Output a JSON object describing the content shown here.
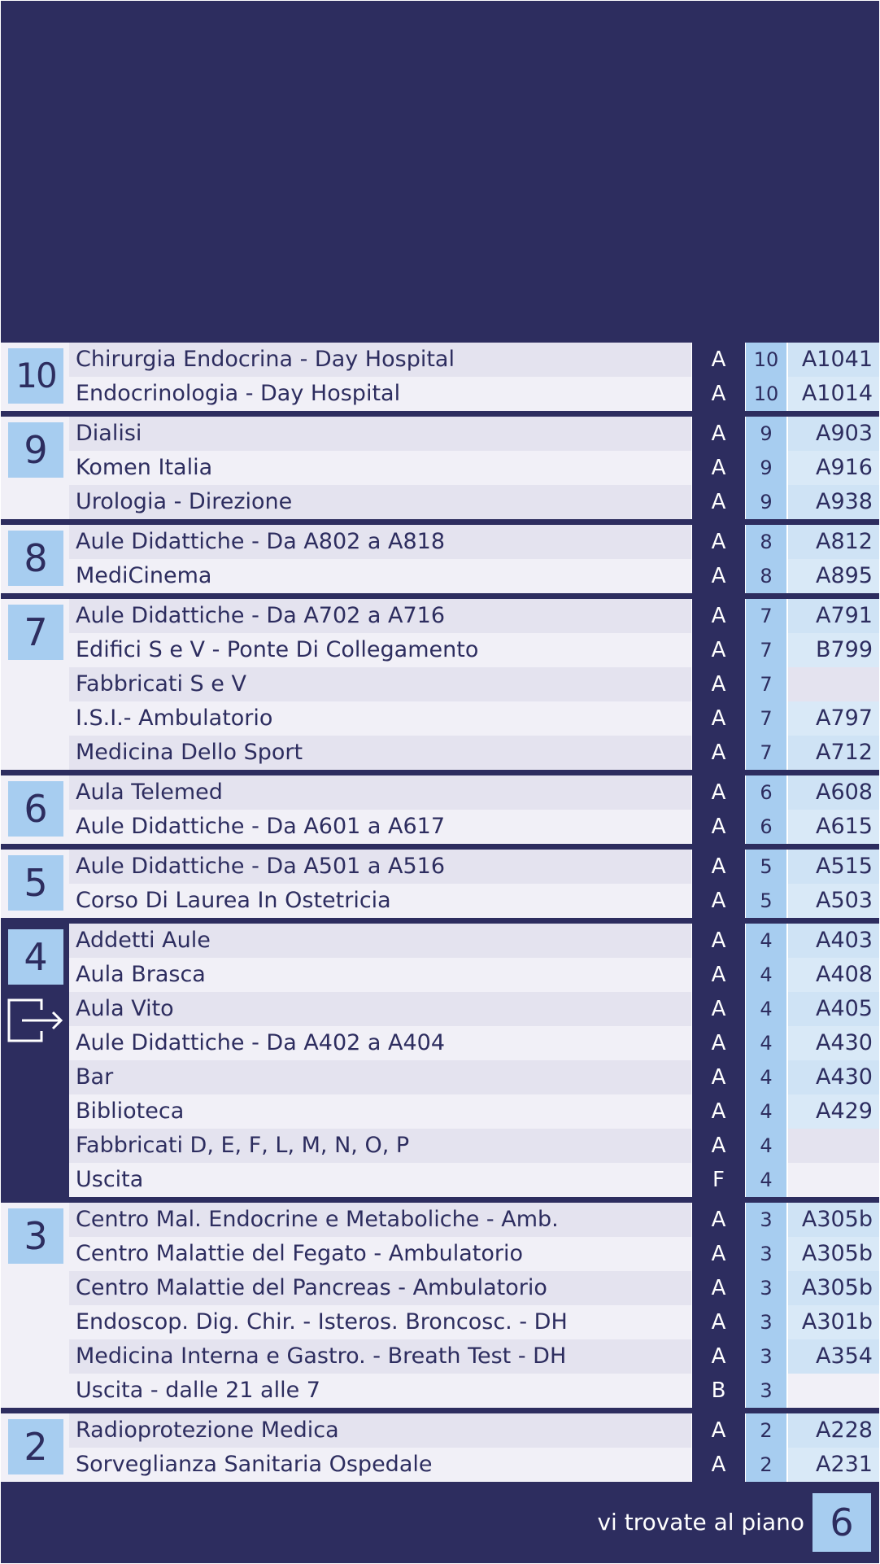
{
  "floors": [
    {
      "number": "10",
      "rows": [
        {
          "name": "Chirurgia Endocrina - Day Hospital",
          "building": "A",
          "floor": "10",
          "room": "A1041"
        },
        {
          "name": "Endocrinologia - Day Hospital",
          "building": "A",
          "floor": "10",
          "room": "A1014"
        }
      ]
    },
    {
      "number": "9",
      "rows": [
        {
          "name": "Dialisi",
          "building": "A",
          "floor": "9",
          "room": "A903"
        },
        {
          "name": "Komen Italia",
          "building": "A",
          "floor": "9",
          "room": "A916"
        },
        {
          "name": "Urologia - Direzione",
          "building": "A",
          "floor": "9",
          "room": "A938"
        }
      ]
    },
    {
      "number": "8",
      "rows": [
        {
          "name": "Aule Didattiche - Da A802 a A818",
          "building": "A",
          "floor": "8",
          "room": "A812"
        },
        {
          "name": "MediCinema",
          "building": "A",
          "floor": "8",
          "room": "A895"
        }
      ]
    },
    {
      "number": "7",
      "rows": [
        {
          "name": "Aule Didattiche - Da A702 a A716",
          "building": "A",
          "floor": "7",
          "room": "A791"
        },
        {
          "name": "Edifici S e V - Ponte Di Collegamento",
          "building": "A",
          "floor": "7",
          "room": "B799"
        },
        {
          "name": "Fabbricati S e V",
          "building": "A",
          "floor": "7",
          "room": ""
        },
        {
          "name": "I.S.I.- Ambulatorio",
          "building": "A",
          "floor": "7",
          "room": "A797"
        },
        {
          "name": "Medicina Dello Sport",
          "building": "A",
          "floor": "7",
          "room": "A712"
        }
      ]
    },
    {
      "number": "6",
      "rows": [
        {
          "name": "Aula Telemed",
          "building": "A",
          "floor": "6",
          "room": "A608"
        },
        {
          "name": "Aule Didattiche - Da A601 a A617",
          "building": "A",
          "floor": "6",
          "room": "A615"
        }
      ]
    },
    {
      "number": "5",
      "rows": [
        {
          "name": "Aule Didattiche - Da A501 a A516",
          "building": "A",
          "floor": "5",
          "room": "A515"
        },
        {
          "name": "Corso Di Laurea In Ostetricia",
          "building": "A",
          "floor": "5",
          "room": "A503"
        }
      ]
    },
    {
      "number": "4",
      "current": true,
      "exit_icon": "exit-arrow-icon",
      "rows": [
        {
          "name": "Addetti Aule",
          "building": "A",
          "floor": "4",
          "room": "A403"
        },
        {
          "name": "Aula Brasca",
          "building": "A",
          "floor": "4",
          "room": "A408"
        },
        {
          "name": "Aula Vito",
          "building": "A",
          "floor": "4",
          "room": "A405"
        },
        {
          "name": "Aule Didattiche - Da A402 a A404",
          "building": "A",
          "floor": "4",
          "room": "A430"
        },
        {
          "name": "Bar",
          "building": "A",
          "floor": "4",
          "room": "A430"
        },
        {
          "name": "Biblioteca",
          "building": "A",
          "floor": "4",
          "room": "A429"
        },
        {
          "name": "Fabbricati D, E, F, L, M, N, O, P",
          "building": "A",
          "floor": "4",
          "room": ""
        },
        {
          "name": "Uscita",
          "building": "F",
          "floor": "4",
          "room": ""
        }
      ]
    },
    {
      "number": "3",
      "rows": [
        {
          "name": "Centro Mal. Endocrine e Metaboliche - Amb.",
          "building": "A",
          "floor": "3",
          "room": "A305b"
        },
        {
          "name": "Centro Malattie del Fegato - Ambulatorio",
          "building": "A",
          "floor": "3",
          "room": "A305b"
        },
        {
          "name": "Centro Malattie del Pancreas - Ambulatorio",
          "building": "A",
          "floor": "3",
          "room": "A305b"
        },
        {
          "name": "Endoscop. Dig. Chir. - Isteros. Broncosc. - DH",
          "building": "A",
          "floor": "3",
          "room": "A301b"
        },
        {
          "name": "Medicina Interna e Gastro. - Breath Test - DH",
          "building": "A",
          "floor": "3",
          "room": "A354"
        },
        {
          "name": "Uscita - dalle 21 alle 7",
          "building": "B",
          "floor": "3",
          "room": ""
        }
      ]
    },
    {
      "number": "2",
      "rows": [
        {
          "name": "Radioprotezione Medica",
          "building": "A",
          "floor": "2",
          "room": "A228"
        },
        {
          "name": "Sorveglianza Sanitaria Ospedale",
          "building": "A",
          "floor": "2",
          "room": "A231"
        }
      ]
    }
  ],
  "footer": {
    "label": "vi trovate al piano",
    "current_floor": "6"
  },
  "colors": {
    "navy": "#2d2d5f",
    "light_blue": "#a7cdf0",
    "row_light": "#f1f0f7",
    "row_shade": "#e4e3ef"
  }
}
